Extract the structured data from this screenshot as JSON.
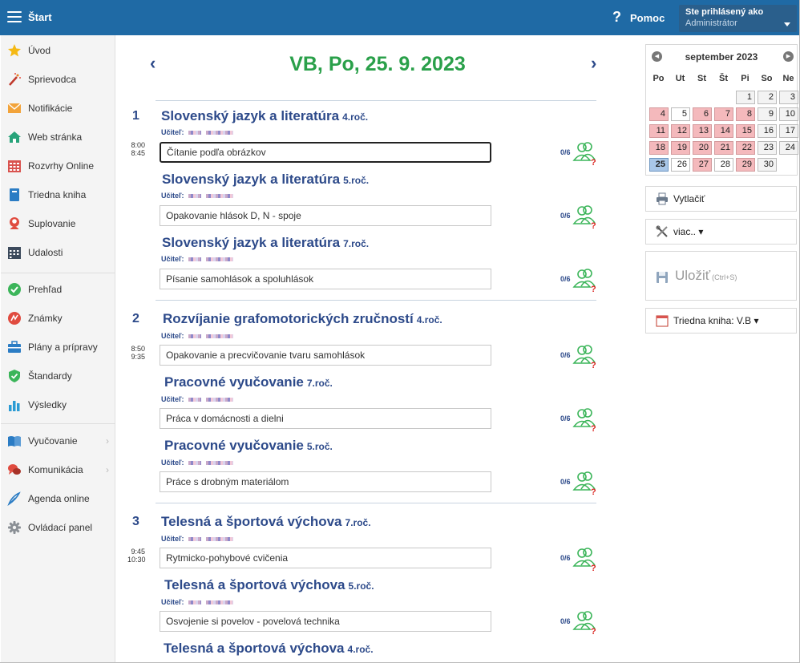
{
  "header": {
    "title": "Štart",
    "help_label": "Pomoc",
    "user_caption": "Ste prihlásený ako",
    "user_name": "Administrátor"
  },
  "sidebar": {
    "items": [
      {
        "label": "Úvod",
        "icon": "star-icon"
      },
      {
        "label": "Sprievodca",
        "icon": "magic-wand-icon"
      },
      {
        "label": "Notifikácie",
        "icon": "envelope-icon"
      },
      {
        "label": "Web stránka",
        "icon": "home-icon"
      },
      {
        "label": "Rozvrhy Online",
        "icon": "timetable-icon"
      },
      {
        "label": "Triedna kniha",
        "icon": "book-icon"
      },
      {
        "label": "Suplovanie",
        "icon": "person-icon"
      },
      {
        "label": "Udalosti",
        "icon": "calendar-icon"
      },
      {
        "label": "Prehľad",
        "icon": "check-circle-icon"
      },
      {
        "label": "Známky",
        "icon": "grade-icon"
      },
      {
        "label": "Plány a prípravy",
        "icon": "briefcase-icon"
      },
      {
        "label": "Štandardy",
        "icon": "shield-check-icon"
      },
      {
        "label": "Výsledky",
        "icon": "bar-chart-icon"
      },
      {
        "label": "Vyučovanie",
        "icon": "open-book-icon"
      },
      {
        "label": "Komunikácia",
        "icon": "chat-icon"
      },
      {
        "label": "Agenda online",
        "icon": "pen-icon"
      },
      {
        "label": "Ovládací panel",
        "icon": "gear-icon"
      }
    ]
  },
  "main": {
    "date_title": "VB, Po, 25. 9. 2023",
    "teacher_label": "Učiteľ:",
    "hours": [
      {
        "num": "1",
        "time_from": "8:00",
        "time_to": "8:45"
      },
      {
        "num": "2",
        "time_from": "8:50",
        "time_to": "9:35"
      },
      {
        "num": "3",
        "time_from": "9:45",
        "time_to": "10:30"
      }
    ],
    "lessons": [
      {
        "subject": "Slovenský jazyk a literatúra",
        "grade": "4.roč.",
        "topic": "Čítanie podľa obrázkov",
        "count": "0/6"
      },
      {
        "subject": "Slovenský jazyk a literatúra",
        "grade": "5.roč.",
        "topic": "Opakovanie hlások D, N - spoje",
        "count": "0/6"
      },
      {
        "subject": "Slovenský jazyk a literatúra",
        "grade": "7.roč.",
        "topic": "Písanie samohlások a spoluhlások",
        "count": "0/6"
      },
      {
        "subject": "Rozvíjanie grafomotorických zručností",
        "grade": "4.roč.",
        "topic": "Opakovanie a precvičovanie tvaru samohlások",
        "count": "0/6"
      },
      {
        "subject": "Pracovné vyučovanie",
        "grade": "7.roč.",
        "topic": "Práca v domácnosti a dielni",
        "count": "0/6"
      },
      {
        "subject": "Pracovné vyučovanie",
        "grade": "5.roč.",
        "topic": "Práce s drobným materiálom",
        "count": "0/6"
      },
      {
        "subject": "Telesná a športová výchova",
        "grade": "7.roč.",
        "topic": "Rytmicko-pohybové cvičenia",
        "count": "0/6"
      },
      {
        "subject": "Telesná a športová výchova",
        "grade": "5.roč.",
        "topic": "Osvojenie si povelov - povelová technika",
        "count": "0/6"
      },
      {
        "subject": "Telesná a športová výchova",
        "grade": "4.roč.",
        "topic": "",
        "count": ""
      }
    ]
  },
  "calendar": {
    "title": "september 2023",
    "dows": [
      "Po",
      "Ut",
      "St",
      "Št",
      "Pi",
      "So",
      "Ne"
    ],
    "weeks": [
      [
        "",
        "",
        "",
        "",
        "1",
        "2",
        "3"
      ],
      [
        "4",
        "5",
        "6",
        "7",
        "8",
        "9",
        "10"
      ],
      [
        "11",
        "12",
        "13",
        "14",
        "15",
        "16",
        "17"
      ],
      [
        "18",
        "19",
        "20",
        "21",
        "22",
        "23",
        "24"
      ],
      [
        "25",
        "26",
        "27",
        "28",
        "29",
        "30",
        ""
      ]
    ],
    "today": "25"
  },
  "right": {
    "print_label": "Vytlačiť",
    "more_label": "viac.. ▾",
    "save_label": "Uložiť",
    "save_hint": "(Ctrl+S)",
    "classbook_label": "Triedna kniha: V.B ▾"
  },
  "colors": {
    "topbar": "#1f6aa5",
    "title_green": "#2aa04a",
    "subject_blue": "#2d4a8a",
    "calendar_red": "#f4b9bc",
    "calendar_today": "#a9c7e8"
  }
}
